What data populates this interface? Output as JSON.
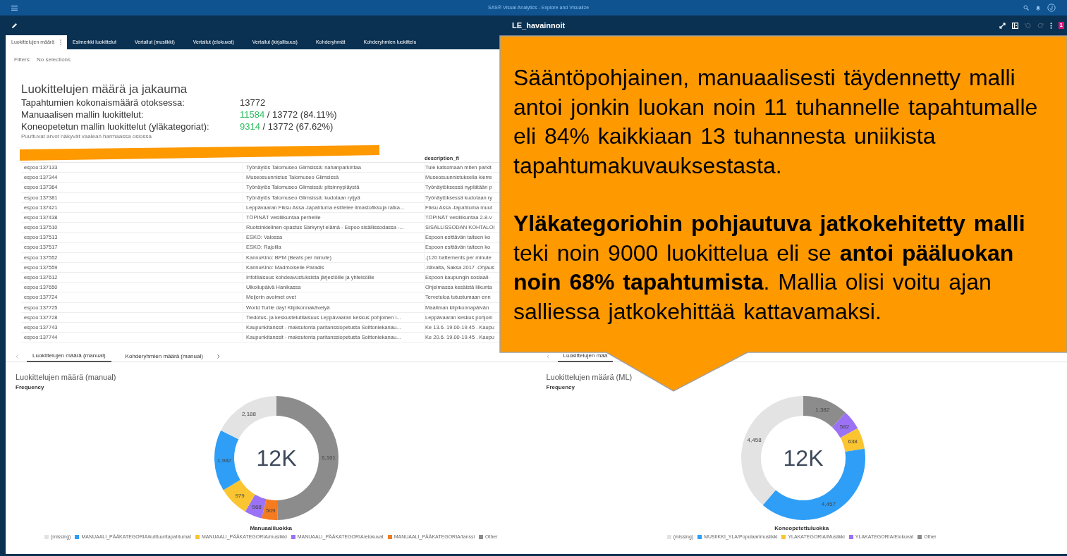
{
  "app_bar": {
    "title": "SAS® Visual Analytics - Explore and Visualize"
  },
  "report_bar": {
    "title": "LE_havainnoit",
    "badge": "1"
  },
  "tabs": [
    {
      "label": "Luokittelujen määrä",
      "selected": true
    },
    {
      "label": "Esimerkki luokittelut",
      "selected": false
    },
    {
      "label": "Vertailut (musiikki)",
      "selected": false
    },
    {
      "label": "Vertailut (elokuvat)",
      "selected": false
    },
    {
      "label": "Vertailut (kirjallisuus)",
      "selected": false
    },
    {
      "label": "Kohderyhmät",
      "selected": false
    },
    {
      "label": "Kohderyhmien luokittelu",
      "selected": false
    }
  ],
  "filters": {
    "label": "Filters:",
    "value": "No selections"
  },
  "summary": {
    "title": "Luokittelujen määrä ja jakauma",
    "rows": [
      {
        "label": "Tapahtumien kokonaismäärä otoksessa:",
        "value": "13772"
      },
      {
        "label": "Manuaalisen mallin luokittelut:",
        "highlight": "11584",
        "value": "/ 13772 (84.11%)"
      },
      {
        "label": "Koneopetetun mallin luokittelut (yläkategoriat):",
        "highlight": "9314",
        "value": "/ 13772 (67.62%)"
      }
    ],
    "note": "Puuttuvat arvot näkyvät vaalean harmaassa osiossa"
  },
  "table": {
    "column_3_heading": "description_fi",
    "rows": [
      [
        "espoo:137133",
        "Työnäytös Talomuseo Glimsissä: nahanparkintaa",
        "Tule katsomaan miten parkit"
      ],
      [
        "espoo:137344",
        "Museosuunnistus Talomuseo Glimsissä",
        "Museosuunnistuksella kierre"
      ],
      [
        "espoo:137364",
        "Työnäytös Talomuseo Glimsissä: pitsinnypläystä",
        "Työnäytöksessä nyplätään p"
      ],
      [
        "espoo:137381",
        "Työnäytös Talomuseo Glimsissä: kudotaan ryijyä",
        "Työnäytöksessä kudotaan ry"
      ],
      [
        "espoo:137421",
        "Leppävaaran Fiksu Assa -tapahtuma esittelee ilmastofiksuja ratka...",
        "Fiksu Assa -tapahtuma muut"
      ],
      [
        "espoo:137438",
        "TÖPINÄT vesiliikuntaa perheille",
        "TÖPINÄT vesiliikuntaa 2-8-v"
      ],
      [
        "espoo:137510",
        "Ruotsinkielinen opastus Särkynyt elämä - Espoo sisällissodassa -...",
        "SISÄLLISSODAN KOHTALOI"
      ],
      [
        "espoo:137513",
        "ESKO: Valossa",
        "Espoon esittävän taiteen ko"
      ],
      [
        "espoo:137517",
        "ESKO: Rajoilla",
        "Espoon esittävän taiteen ko"
      ],
      [
        "espoo:137552",
        "KannuKino: BPM (Beats per minute)",
        ".(120 battements per minute"
      ],
      [
        "espoo:137559",
        "KannuKino: Madmoiselle Paradis",
        ".Itävalta, Saksa 2017 .Ohjaus"
      ],
      [
        "espoo:137612",
        "Infotilaisuus kohdeavustuksista järjestöille ja yhteisöille",
        "Espoon kaupungin sosiaali-"
      ],
      [
        "espoo:137650",
        "Ulkoilupäivä Hanikassa",
        "Ohjelmassa kesäistä liikunta"
      ],
      [
        "espoo:137724",
        "Meijerin avoimet ovet",
        "Tervetuloa tutustumaan enn"
      ],
      [
        "espoo:137725",
        "World Turtle day! Kilpikonnakävelyä",
        "Maailman kilpikonnapäivän"
      ],
      [
        "espoo:137728",
        "Tiedotus- ja keskustelutilaisuus Leppävaaran keskus pohjoinen l...",
        "Leppävaaran keskus pohjoin"
      ],
      [
        "espoo:137743",
        "Kaupunkitanssit - maksutonta paritanssiopetusta Soittoniekanau...",
        "Ke 13.6. 19.00-19.45 . Kaupu"
      ],
      [
        "espoo:137744",
        "Kaupunkitanssit - maksutonta paritanssiopetusta Soittoniekanau...",
        "Ke 20.6. 19.00-19.45 . Kaupu"
      ]
    ]
  },
  "chart_panels": [
    {
      "tabs": [
        {
          "label": "Luokittelujen määrä (manual)",
          "selected": true
        },
        {
          "label": "Kohderyhmien määrä (manual)",
          "selected": false
        }
      ],
      "title": "Luokittelujen määrä (manual)",
      "center_label": "12K",
      "legend": [
        {
          "color": "#e3e3e3"
        },
        {
          "color": "#2e9ef7"
        },
        {
          "color": "#fbc531"
        },
        {
          "color": "#9b72f6"
        },
        {
          "color": "#f47b20"
        },
        {
          "color": "#8c8c8c"
        }
      ],
      "chart_data": {
        "type": "donut",
        "ylabel": "Frequency",
        "xlabel": "Manuaaliluokka",
        "categories": [
          "(missing)",
          "MANUAALI_PÄÄKATEGORIA/kulttuuritapahtumat",
          "MANUAALI_PÄÄKATEGORIA/musiikki",
          "MANUAALI_PÄÄKATEGORIA/elokuvat",
          "MANUAALI_PÄÄKATEGORIA/tanssi",
          "Other"
        ],
        "values": [
          2188,
          1982,
          979,
          568,
          509,
          6161
        ],
        "value_labels": [
          "2,188",
          "1,982",
          "979",
          "568",
          "509",
          "6,161"
        ]
      }
    },
    {
      "tabs": [
        {
          "label": "Luokittelujen mää",
          "selected": true
        }
      ],
      "title": "Luokittelujen määrä (ML)",
      "center_label": "12K",
      "legend": [
        {
          "color": "#e3e3e3"
        },
        {
          "color": "#2e9ef7"
        },
        {
          "color": "#fbc531"
        },
        {
          "color": "#9b72f6"
        },
        {
          "color": "#8c8c8c"
        }
      ],
      "chart_data": {
        "type": "donut",
        "ylabel": "Frequency",
        "xlabel": "Koneopetettuluokka",
        "categories": [
          "(missing)",
          "MUSIIKKI_YLA/Populaarimusiikki",
          "YLAKATEGORIA/Musiikki",
          "YLAKATEGORIA/Elokuvat",
          "Other"
        ],
        "values": [
          4458,
          4457,
          638,
          582,
          1382
        ],
        "value_labels": [
          "4,458",
          "4,457",
          "638",
          "582",
          "1,382"
        ]
      }
    }
  ],
  "callout": {
    "paragraphs": [
      "Sääntöpohjainen, manuaalisesti täydennetty malli\nantoi jonkin luokan noin 11 tuhannelle tapahtumalle\neli 84% kaikkiaan 13 tuhannesta uniikista\ntapahtumakuvauksestasta.",
      "**Yläkategoriohin pohjautuva jatkokehitetty malli**\nteki noin 9000 luokittelua eli se **antoi pääluokan**\n**noin 68% tapahtumista**. Mallia olisi voitu ajan\nsalliessa jatkokehittää kattavamaksi."
    ]
  }
}
